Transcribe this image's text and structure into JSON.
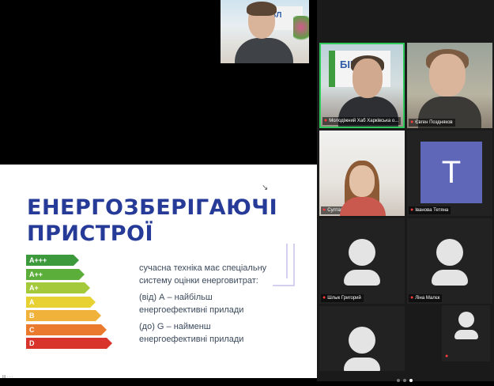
{
  "speaker": {
    "banner_text": "БІБЛ"
  },
  "slide": {
    "title_line1": "ЕНЕРГОЗБЕРІГАЮЧІ",
    "title_line2": "ПРИСТРОЇ",
    "cursor": "↘",
    "energy_classes": [
      {
        "label": "A+++",
        "color": "#3d9a3c"
      },
      {
        "label": "A++",
        "color": "#5cae3a"
      },
      {
        "label": "A+",
        "color": "#a4c93a"
      },
      {
        "label": "A",
        "color": "#e8d233"
      },
      {
        "label": "B",
        "color": "#f0b23a"
      },
      {
        "label": "C",
        "color": "#ea7a2e"
      },
      {
        "label": "D",
        "color": "#d8342c"
      }
    ],
    "desc_line1": "сучасна техніка має спеціальну",
    "desc_line2": "систему оцінки енерговитрат:",
    "desc_line3": "(від) А – найбільш",
    "desc_line4": "енергоефективні прилади",
    "desc_line5": "(до) G – найменш",
    "desc_line6": "енергоефективні прилади",
    "footer": "III  ·  ·  ·"
  },
  "gallery": {
    "tiles": [
      {
        "name": "Молодіжний Хаб Харківська о...",
        "banner": "ХАРК\nБІБЛ",
        "active": true
      },
      {
        "name": "Євген Поздняков",
        "active": false
      },
      {
        "name": "Султанова Алиса",
        "active": false
      },
      {
        "name": "Іванова Тетяна",
        "initial": "T",
        "active": false
      },
      {
        "name": "Шлык Григорий",
        "active": false
      },
      {
        "name": "Ліна Малєк",
        "active": false
      },
      {
        "name": "",
        "active": false
      }
    ],
    "page_dots": 3,
    "current_page": 3
  },
  "colors": {
    "active_border": "#2fca5b",
    "muted_mic": "#ff3b3b",
    "title": "#263a98",
    "initial_bg": "#5f67b9"
  },
  "icons": {
    "mic": "mic-muted-icon"
  }
}
